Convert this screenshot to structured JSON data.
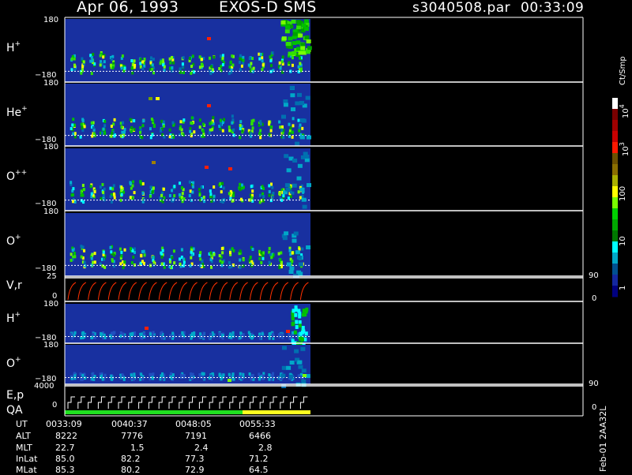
{
  "header": {
    "date": "Apr 06, 1993",
    "instrument": "EXOS-D SMS",
    "file": "s3040508.par",
    "time": "00:33:09"
  },
  "panels": [
    {
      "id": "h1",
      "label": "H",
      "sup": "+",
      "top": "180",
      "bottom": "−180"
    },
    {
      "id": "he1",
      "label": "He",
      "sup": "+",
      "top": "180",
      "bottom": "−180"
    },
    {
      "id": "opp",
      "label": "O",
      "sup": "++",
      "top": "180",
      "bottom": "−180"
    },
    {
      "id": "o1",
      "label": "O",
      "sup": "+",
      "top": "180",
      "bottom": "−180"
    },
    {
      "id": "vr",
      "label": "V,r",
      "top": "25",
      "bottom": "0",
      "right_top": "90",
      "right_bottom": "0"
    },
    {
      "id": "h2",
      "label": "H",
      "sup": "+",
      "top": "180",
      "bottom": "−180"
    },
    {
      "id": "o2",
      "label": "O",
      "sup": "+",
      "top": "180",
      "bottom": "−180"
    },
    {
      "id": "ep",
      "label": "E,p",
      "label2": "QA",
      "top": "4000",
      "bottom": "0",
      "right_top": "90",
      "right_bottom": "0"
    }
  ],
  "colorbar": {
    "unit": "Ct/Smp",
    "ticks": [
      {
        "base": "10",
        "exp": "4"
      },
      {
        "base": "10",
        "exp": "3"
      },
      {
        "base": "100",
        "exp": ""
      },
      {
        "base": "10",
        "exp": ""
      },
      {
        "base": "1",
        "exp": ""
      }
    ],
    "colors": [
      "#ffffff",
      "#7a0000",
      "#a00000",
      "#c80000",
      "#ff1800",
      "#6b5000",
      "#8a6e00",
      "#aab000",
      "#ffff00",
      "#78ff00",
      "#00d000",
      "#00a800",
      "#007800",
      "#00ffff",
      "#00a8c8",
      "#005090",
      "#1428a0",
      "#000080"
    ]
  },
  "footer": {
    "rows": [
      {
        "name": "UT",
        "values": [
          "0033:09",
          "0040:37",
          "0048:05",
          "0055:33"
        ]
      },
      {
        "name": "ALT",
        "values": [
          "8222",
          "7776",
          "7191",
          "6466"
        ]
      },
      {
        "name": "MLT",
        "values": [
          "22.7",
          "1.5",
          "2.4",
          "2.8"
        ]
      },
      {
        "name": "InLat",
        "values": [
          "85.0",
          "82.2",
          "77.3",
          "71.2"
        ]
      },
      {
        "name": "MLat",
        "values": [
          "85.3",
          "80.2",
          "72.9",
          "64.5"
        ]
      }
    ],
    "stamp": "Feb-01 2AA32L"
  },
  "chart_data": {
    "type": "heatmap",
    "title": "Apr 06, 1993   EXOS-D SMS",
    "x_ticks": [
      "0033:09",
      "0040:37",
      "0048:05",
      "0055:33"
    ],
    "panels": [
      "H+",
      "He+",
      "O++",
      "O+",
      "V,r",
      "H+",
      "O+",
      "E,p QA"
    ],
    "y_range_pitch_angle": [
      -180,
      180
    ],
    "vr_range": [
      0,
      25
    ],
    "ep_range": [
      0,
      4000
    ],
    "colorbar_scale": "log",
    "colorbar_range": [
      1,
      10000
    ],
    "colorbar_unit": "Ct/Smp"
  }
}
